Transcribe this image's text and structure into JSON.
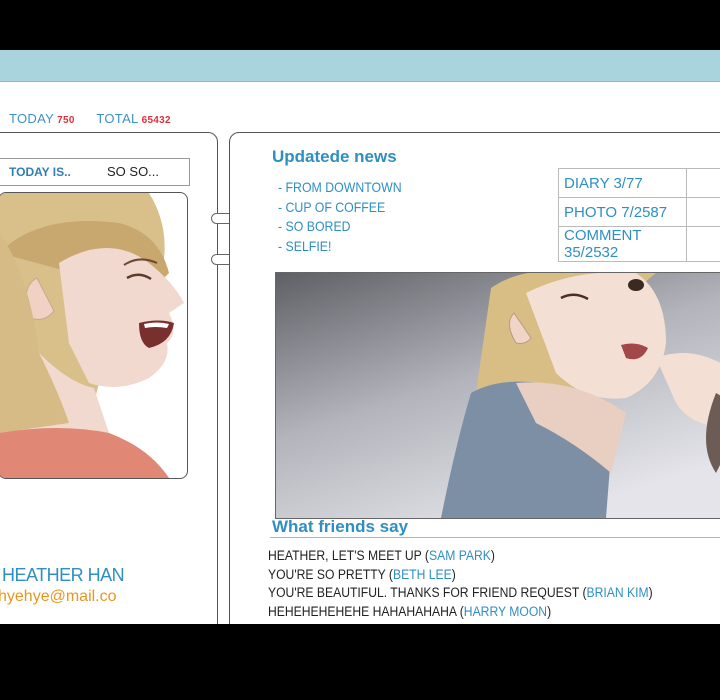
{
  "counter": {
    "today_label": "TODAY",
    "today_value": "750",
    "total_label": "TOTAL",
    "total_value": "65432"
  },
  "profile": {
    "today_is_label": "TODAY IS..",
    "mood": "SO SO...",
    "name": "HEATHER HAN",
    "email": "hyehye@mail.co"
  },
  "news": {
    "title": "Updatede news",
    "items": [
      "- FROM DOWNTOWN",
      "- CUP OF COFFEE",
      "- SO BORED",
      "- SELFIE!"
    ]
  },
  "stats": {
    "diary": "DIARY 3/77",
    "photo": "PHOTO 7/2587",
    "comment": "COMMENT 35/2532"
  },
  "friends": {
    "title": "What friends say",
    "comments": [
      {
        "text": "HEATHER, LET'S MEET UP (",
        "name": "SAM PARK",
        "close": ")"
      },
      {
        "text": "YOU'RE SO PRETTY (",
        "name": "BETH LEE",
        "close": ")"
      },
      {
        "text": "YOU'RE BEAUTIFUL. THANKS FOR FRIEND REQUEST (",
        "name": "BRIAN KIM",
        "close": ")"
      },
      {
        "text": "HEHEHEHEHEHE HAHAHAHAHA (",
        "name": "HARRY MOON",
        "close": ")"
      }
    ]
  },
  "colors": {
    "accent": "#2f8fc1",
    "topbar": "#a9d4dd",
    "count_red": "#e0303a",
    "email_orange": "#e8961e"
  }
}
